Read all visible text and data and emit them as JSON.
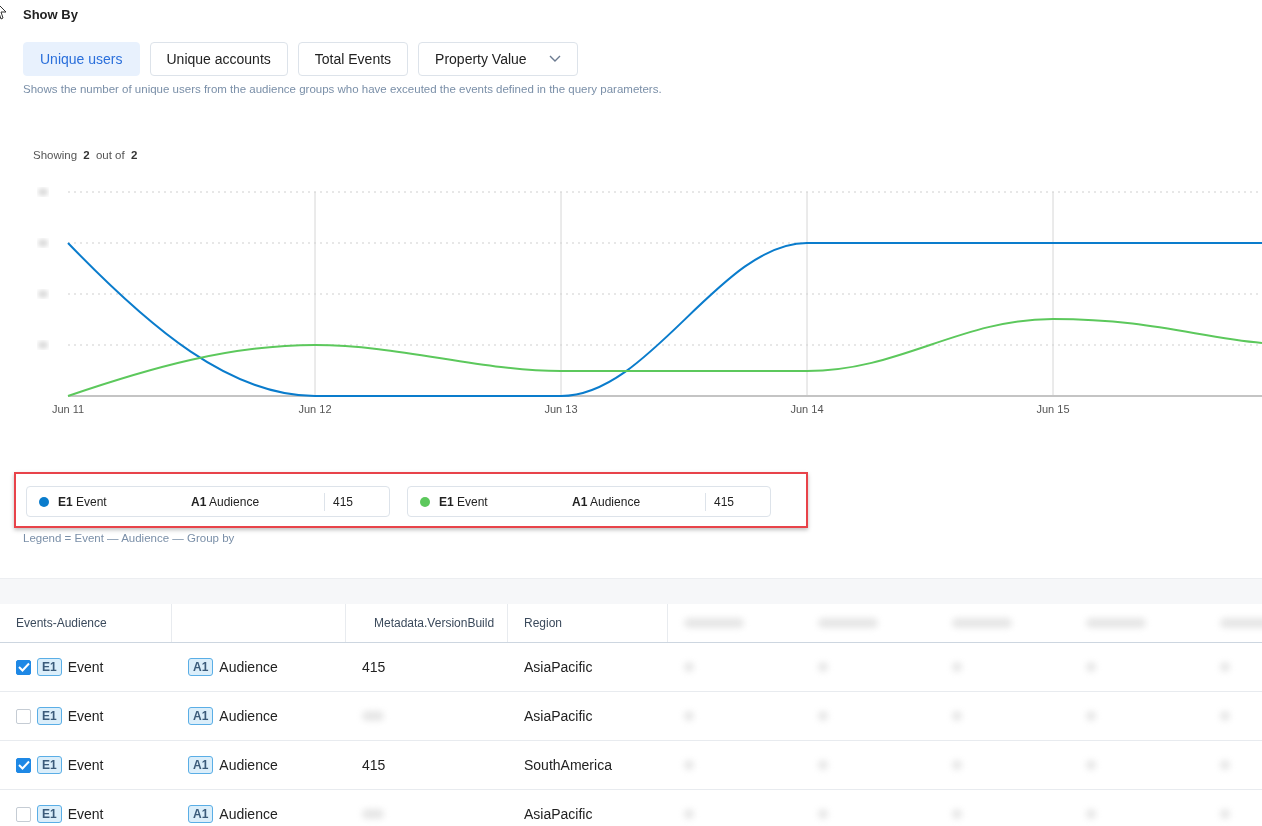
{
  "show_by": {
    "title": "Show By",
    "options": [
      {
        "label": "Unique users",
        "kind": "button",
        "selected": true
      },
      {
        "label": "Unique accounts",
        "kind": "button",
        "selected": false
      },
      {
        "label": "Total Events",
        "kind": "button",
        "selected": false
      },
      {
        "label": "Property Value",
        "kind": "dropdown",
        "selected": false
      }
    ],
    "description": "Shows the number of unique users from the audience groups who have exceuted the events defined in the query parameters."
  },
  "chart": {
    "showing": "Showing **2** out of **2**",
    "x_labels": [
      "Jun 11",
      "Jun 12",
      "Jun 13",
      "Jun 14",
      "Jun 15"
    ]
  },
  "legend": {
    "highlighted": true,
    "items": [
      {
        "color": "#0a7ccc",
        "event_tag": "E1",
        "event": "Event",
        "audience_tag": "A1",
        "audience": "Audience",
        "value": "415"
      },
      {
        "color": "#5cc85c",
        "event_tag": "E1",
        "event": "Event",
        "audience_tag": "A1",
        "audience": "Audience",
        "value": "415"
      }
    ],
    "note": "Legend = Event — Audience — Group by"
  },
  "table": {
    "columns": [
      "Events-Audience",
      "Metadata.VersionBuild",
      "Region"
    ],
    "rows": [
      {
        "checked": true,
        "event_tag": "E1",
        "event": "Event",
        "audience_tag": "A1",
        "audience": "Audience",
        "version": "415",
        "region": "AsiaPacific"
      },
      {
        "checked": false,
        "event_tag": "E1",
        "event": "Event",
        "audience_tag": "A1",
        "audience": "Audience",
        "region": "AsiaPacific"
      },
      {
        "checked": true,
        "event_tag": "E1",
        "event": "Event",
        "audience_tag": "A1",
        "audience": "Audience",
        "version": "415",
        "region": "SouthAmerica"
      },
      {
        "checked": false,
        "event_tag": "E1",
        "event": "Event",
        "audience_tag": "A1",
        "audience": "Audience",
        "region": "AsiaPacific"
      }
    ]
  }
}
